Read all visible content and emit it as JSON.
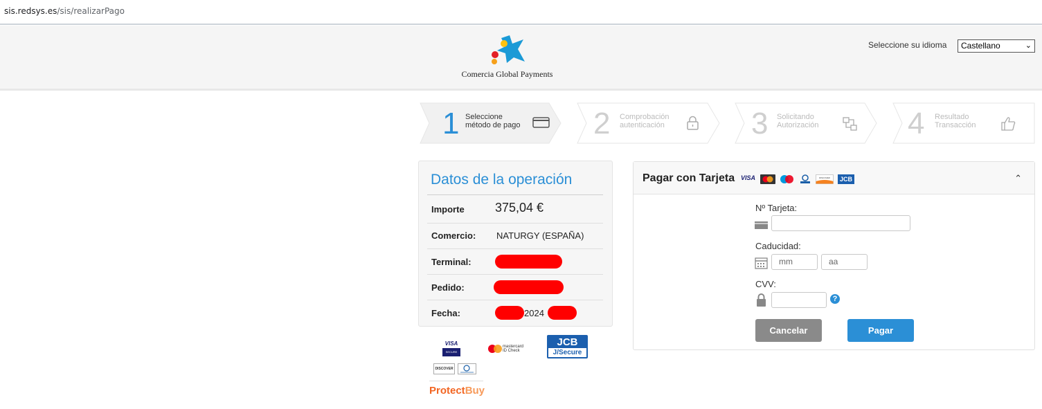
{
  "browser": {
    "url_host": "sis.redsys.es",
    "url_path": "/sis/realizarPago"
  },
  "header": {
    "logo_text": "Comercia Global Payments",
    "language_label": "Seleccione su idioma",
    "language_selected": "Castellano"
  },
  "steps": [
    {
      "number": "1",
      "line1": "Seleccione",
      "line2": "método de pago",
      "icon": "credit-card-icon",
      "active": true
    },
    {
      "number": "2",
      "line1": "Comprobación",
      "line2": "autenticación",
      "icon": "lock-icon",
      "active": false
    },
    {
      "number": "3",
      "line1": "Solicitando",
      "line2": "Autorización",
      "icon": "network-icon",
      "active": false
    },
    {
      "number": "4",
      "line1": "Resultado",
      "line2": "Transacción",
      "icon": "thumbs-up-icon",
      "active": false
    }
  ],
  "operation": {
    "title": "Datos de la operación",
    "amount_label": "Importe",
    "amount_value": "375,04 €",
    "merchant_label": "Comercio:",
    "merchant_value": "NATURGY (ESPAÑA)",
    "terminal_label": "Terminal:",
    "order_label": "Pedido:",
    "date_label": "Fecha:",
    "date_visible": "2024"
  },
  "security_logos": {
    "visa_line1": "VISA",
    "visa_line2": "SECURE",
    "mastercard_line1": "mastercard",
    "mastercard_line2": "ID Check",
    "jcb_line1": "JCB",
    "jcb_line2": "J/Secure",
    "discover": "DISCOVER",
    "protectbuy_main": "Protect",
    "protectbuy_suffix": "Buy"
  },
  "card_form": {
    "title": "Pagar con Tarjeta",
    "brands": [
      "VISA",
      "JCB",
      "DISCOVER"
    ],
    "card_number_label": "Nº Tarjeta:",
    "expiry_label": "Caducidad:",
    "month_placeholder": "mm",
    "year_placeholder": "aa",
    "cvv_label": "CVV:",
    "help_glyph": "?",
    "cancel_label": "Cancelar",
    "pay_label": "Pagar"
  },
  "colors": {
    "accent": "#2b8fd6",
    "cancel": "#8a8a8a",
    "redaction": "#ff0000"
  }
}
